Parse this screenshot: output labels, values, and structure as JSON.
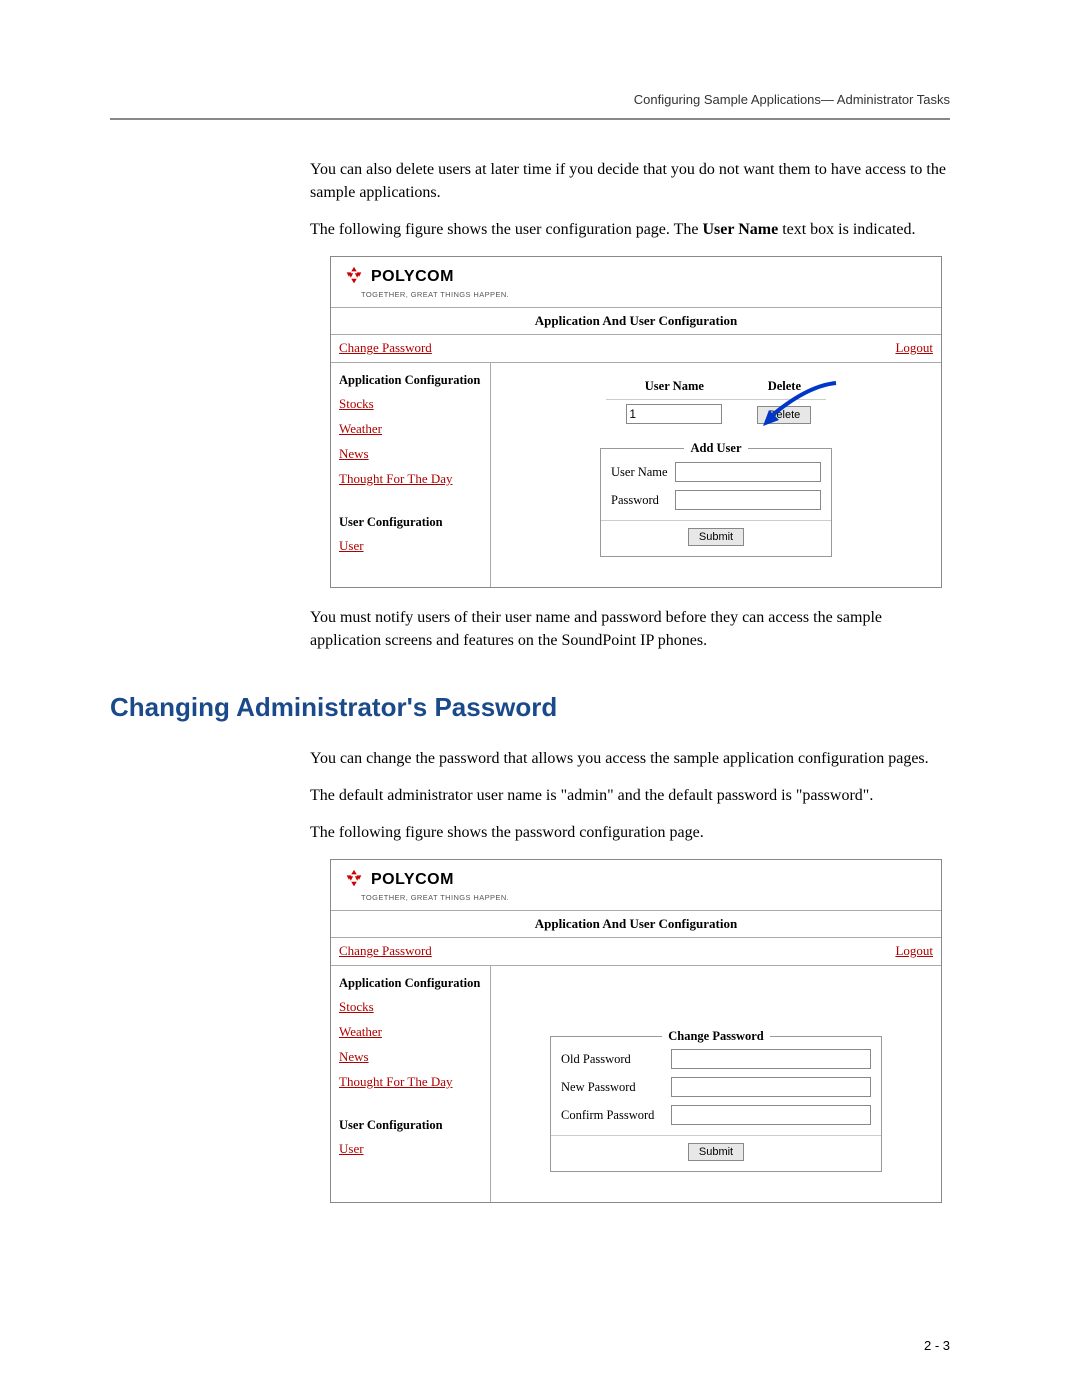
{
  "header": {
    "running_head": "Configuring Sample Applications— Administrator Tasks"
  },
  "body": {
    "p1": "You can also delete users at later time if you decide that you do not want them to have access to the sample applications.",
    "p2a": "The following figure shows the user configuration page. The ",
    "p2b": "User Name",
    "p2c": " text box is indicated.",
    "p3": "You must notify users of their user name and password before they can access the sample application screens and features on the SoundPoint IP phones.",
    "h2": "Changing Administrator's Password",
    "p4": "You can change the password that allows you access the sample application configuration pages.",
    "p5": "The default administrator user name is \"admin\" and the default password is \"password\".",
    "p6": "The following figure shows the password configuration page."
  },
  "screenshot_common": {
    "logo_text": "POLYCOM",
    "logo_tagline": "TOGETHER, GREAT THINGS HAPPEN.",
    "title": "Application And User Configuration",
    "change_password": "Change Password",
    "logout": "Logout",
    "side_app_cfg": "Application Configuration",
    "side_stocks": "Stocks",
    "side_weather": "Weather",
    "side_news": "News",
    "side_thought": "Thought For The Day",
    "side_user_cfg": "User Configuration",
    "side_user": "User"
  },
  "ss1": {
    "th_user": "User Name",
    "th_delete": "Delete",
    "row1_user": "1",
    "row1_delete_btn": "Delete",
    "add_user_title": "Add User",
    "label_username": "User Name",
    "label_password": "Password",
    "submit": "Submit"
  },
  "ss2": {
    "pane_title": "Change Password",
    "label_old": "Old Password",
    "label_new": "New Password",
    "label_confirm": "Confirm Password",
    "submit": "Submit"
  },
  "footer": {
    "page_num": "2 - 3"
  }
}
